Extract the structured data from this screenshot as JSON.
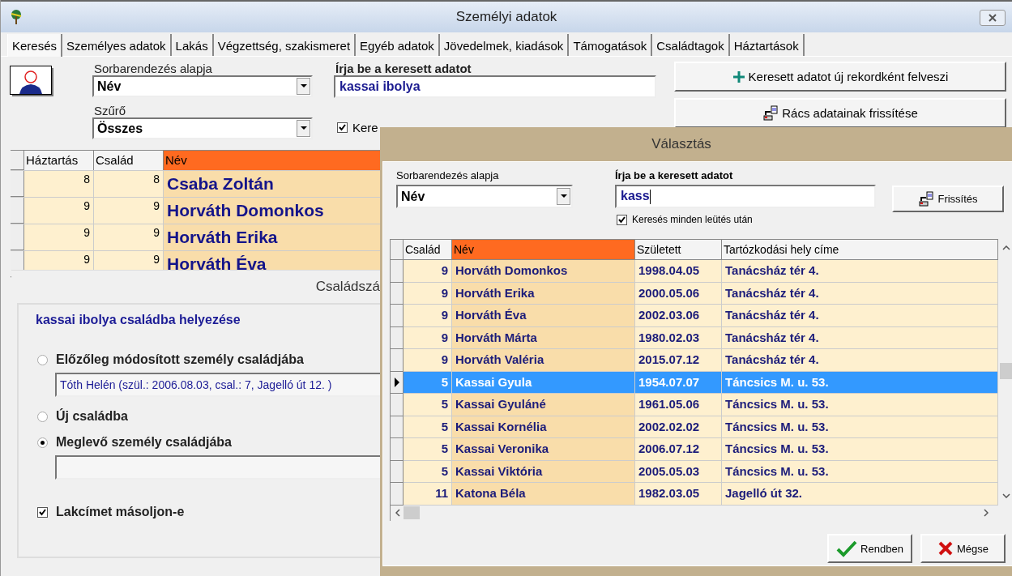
{
  "window": {
    "title": "Személyi adatok"
  },
  "tabs": [
    {
      "label": "Keresés",
      "selected": true
    },
    {
      "label": "Személyes adatok",
      "selected": false
    },
    {
      "label": "Lakás",
      "selected": false
    },
    {
      "label": "Végzettség, szakismeret",
      "selected": false
    },
    {
      "label": "Egyéb adatok",
      "selected": false
    },
    {
      "label": "Jövedelmek, kiadások",
      "selected": false
    },
    {
      "label": "Támogatások",
      "selected": false
    },
    {
      "label": "Családtagok",
      "selected": false
    },
    {
      "label": "Háztartások",
      "selected": false
    }
  ],
  "search_panel": {
    "sort_label": "Sorbarendezés alapja",
    "sort_value": "Név",
    "filter_label": "Szűrő",
    "filter_value": "Összes",
    "search_label": "Írja be a keresett adatot",
    "search_value": "kassai ibolya",
    "search_each_key": {
      "label": "Kere",
      "checked": true
    },
    "buttons": [
      {
        "label": "Keresett adatot új rekordként felveszi",
        "kind": "add"
      },
      {
        "label": "Rács adatainak frissítése",
        "kind": "refresh"
      }
    ]
  },
  "grid": {
    "columns": [
      {
        "label": "Háztartás",
        "sorted": false
      },
      {
        "label": "Család",
        "sorted": false
      },
      {
        "label": "Név",
        "sorted": true
      }
    ],
    "rows": [
      {
        "household": "8",
        "family": "8",
        "name": "Csaba Zoltán"
      },
      {
        "household": "9",
        "family": "9",
        "name": "Horváth Domonkos"
      },
      {
        "household": "9",
        "family": "9",
        "name": "Horváth Erika"
      },
      {
        "household": "9",
        "family": "9",
        "name": "Horváth Éva"
      }
    ]
  },
  "family_dialog": {
    "title": "Családszá",
    "heading": "kassai ibolya családba helyezése",
    "options": [
      {
        "label": "Előzőleg módosított személy családjába",
        "selected": false,
        "kind": "with_field",
        "field_value": "Tóth Helén (szül.: 2006.08.03, csal.: 7, Jagelló út 12. )"
      },
      {
        "label": "Új családba",
        "selected": false,
        "kind": "plain"
      },
      {
        "label": "Meglevő személy családjába",
        "selected": true,
        "kind": "with_field"
      }
    ],
    "copy_address": {
      "label": "Lakcímet másoljon-e",
      "checked": true
    }
  },
  "select_dialog": {
    "title": "Választás",
    "sort_label": "Sorbarendezés alapja",
    "sort_value": "Név",
    "search_label": "Írja be a keresett adatot",
    "search_value": "kass",
    "refresh_button": "Frissítés",
    "search_each_key": {
      "label": "Keresés minden leütés után",
      "checked": true
    },
    "columns": [
      {
        "label": "Család",
        "sorted": false
      },
      {
        "label": "Név",
        "sorted": true
      },
      {
        "label": "Született",
        "sorted": false
      },
      {
        "label": "Tartózkodási hely címe",
        "sorted": false
      }
    ],
    "rows": [
      {
        "family": "9",
        "name": "Horváth Domonkos",
        "born": "1998.04.05",
        "address": "Tanácsház tér 4.",
        "selected": false
      },
      {
        "family": "9",
        "name": "Horváth Erika",
        "born": "2000.05.06",
        "address": "Tanácsház tér 4.",
        "selected": false
      },
      {
        "family": "9",
        "name": "Horváth Éva",
        "born": "2002.03.06",
        "address": "Tanácsház tér 4.",
        "selected": false
      },
      {
        "family": "9",
        "name": "Horváth Márta",
        "born": "1980.02.03",
        "address": "Tanácsház tér 4.",
        "selected": false
      },
      {
        "family": "9",
        "name": "Horváth Valéria",
        "born": "2015.07.12",
        "address": "Tanácsház tér 4.",
        "selected": false
      },
      {
        "family": "5",
        "name": "Kassai Gyula",
        "born": "1954.07.07",
        "address": "Táncsics M. u. 53.",
        "selected": true
      },
      {
        "family": "5",
        "name": "Kassai Gyuláné",
        "born": "1961.05.06",
        "address": "Táncsics M. u. 53.",
        "selected": false
      },
      {
        "family": "5",
        "name": "Kassai Kornélia",
        "born": "2002.02.02",
        "address": "Táncsics M. u. 53.",
        "selected": false
      },
      {
        "family": "5",
        "name": "Kassai Veronika",
        "born": "2006.07.12",
        "address": "Táncsics M. u. 53.",
        "selected": false
      },
      {
        "family": "5",
        "name": "Kassai Viktória",
        "born": "2005.05.03",
        "address": "Táncsics M. u. 53.",
        "selected": false
      },
      {
        "family": "11",
        "name": "Katona Béla",
        "born": "1982.03.05",
        "address": "Jagelló út 32.",
        "selected": false
      }
    ],
    "buttons": [
      {
        "label": "Rendben",
        "kind": "ok"
      },
      {
        "label": "Mégse",
        "kind": "cancel"
      }
    ]
  }
}
